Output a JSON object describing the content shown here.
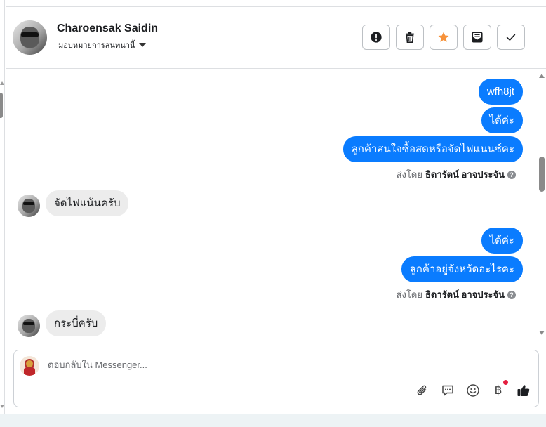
{
  "header": {
    "contact_name": "Charoensak Saidin",
    "assign_label": "มอบหมายการสนทนานี้",
    "actions": [
      {
        "name": "mark-spam-button",
        "icon": "alert-circle-icon"
      },
      {
        "name": "delete-button",
        "icon": "trash-icon"
      },
      {
        "name": "star-button",
        "icon": "star-icon",
        "color": "#f7923a"
      },
      {
        "name": "mark-unread-button",
        "icon": "mail-icon"
      },
      {
        "name": "mark-done-button",
        "icon": "check-icon"
      }
    ]
  },
  "messages": [
    {
      "direction": "out",
      "text": "wfh8jt"
    },
    {
      "direction": "out",
      "text": "ได้ค่ะ"
    },
    {
      "direction": "out",
      "text": "ลูกค้าสนใจซื้อสดหรือจัดไฟแนนซ์คะ"
    },
    {
      "direction": "meta",
      "prefix": "ส่งโดย",
      "agent": "ธิดารัตน์ อาจประจัน"
    },
    {
      "direction": "in",
      "text": "จัดไฟแน้นครับ"
    },
    {
      "direction": "out",
      "text": "ได้ค่ะ"
    },
    {
      "direction": "out",
      "text": "ลูกค้าอยู่จังหวัดอะไรคะ"
    },
    {
      "direction": "meta",
      "prefix": "ส่งโดย",
      "agent": "ธิดารัตน์ อาจประจัน"
    },
    {
      "direction": "in",
      "text": "กระบี่ครับ"
    }
  ],
  "composer": {
    "placeholder": "ตอบกลับใน Messenger...",
    "tools": [
      "paperclip-icon",
      "speech-bubble-icon",
      "smiley-icon",
      "baht-icon",
      "thumbs-up-icon"
    ],
    "baht_symbol": "฿",
    "send_color": "#1c1e21"
  },
  "colors": {
    "outgoing_bubble": "#0a7cff",
    "incoming_bubble": "#ececec"
  }
}
